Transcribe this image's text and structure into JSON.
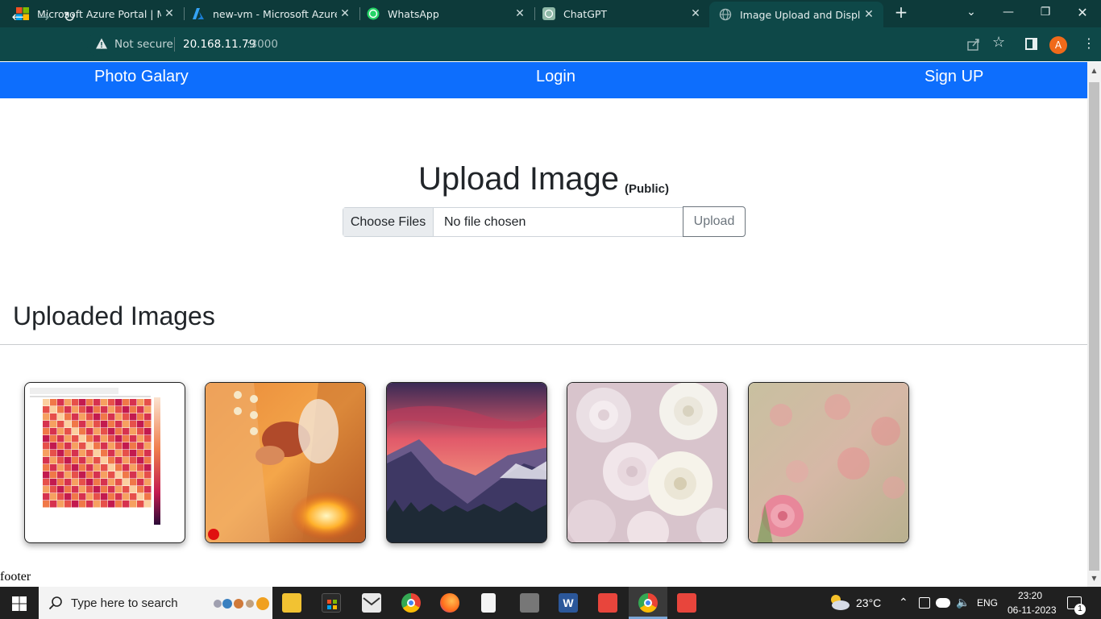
{
  "browser": {
    "tabs": [
      {
        "title": "Microsoft Azure Portal | Micr",
        "icon": "microsoft-logo-icon"
      },
      {
        "title": "new-vm - Microsoft Azure",
        "icon": "azure-logo-icon"
      },
      {
        "title": "WhatsApp",
        "icon": "whatsapp-icon"
      },
      {
        "title": "ChatGPT",
        "icon": "chatgpt-icon"
      },
      {
        "title": "Image Upload and Display",
        "icon": "globe-icon",
        "active": true
      }
    ],
    "security_label": "Not secure",
    "url_host": "20.168.11.79",
    "url_port": ":3000",
    "profile_initial": "A"
  },
  "page": {
    "navbar": {
      "brand": "Photo Galary",
      "login": "Login",
      "signup": "Sign UP",
      "color": "#0d6efd"
    },
    "upload": {
      "title": "Upload Image",
      "subtitle": "(Public)",
      "choose_label": "Choose Files",
      "file_status": "No file chosen",
      "button_label": "Upload"
    },
    "gallery": {
      "title": "Uploaded Images",
      "images": [
        {
          "subject": "correlation heatmap chart"
        },
        {
          "subject": "wedding ceremony hands with mehndi"
        },
        {
          "subject": "mountain valley at sunset"
        },
        {
          "subject": "white and pink roses"
        },
        {
          "subject": "pink roses blurred background"
        }
      ]
    },
    "footer": "footer"
  },
  "taskbar": {
    "search_placeholder": "Type here to search",
    "weather": "23°C",
    "language": "ENG",
    "time": "23:20",
    "date": "06-11-2023",
    "notification_count": "1"
  }
}
